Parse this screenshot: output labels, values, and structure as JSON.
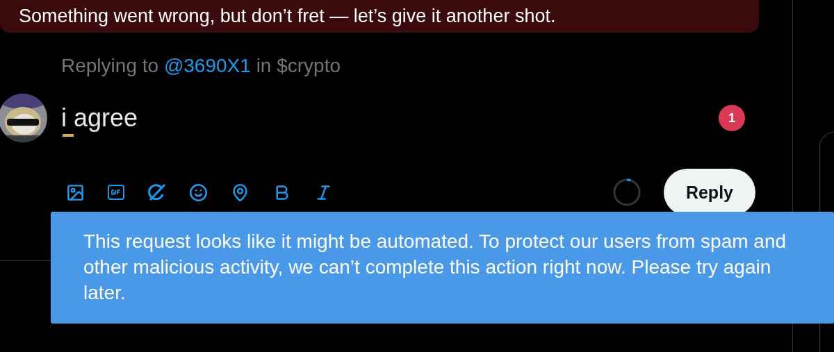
{
  "error_banner": {
    "text": "Something went wrong, but don’t fret — let’s give it another shot."
  },
  "replying_to": {
    "prefix": "Replying to",
    "handle": "@3690X1",
    "suffix": "in $crypto"
  },
  "composer": {
    "text": "i agree",
    "spellcheck_word_flagged": true,
    "badge": "1",
    "level": 0.05
  },
  "toolbar": [
    {
      "kind": "image"
    },
    {
      "kind": "gif"
    },
    {
      "kind": "grok"
    },
    {
      "kind": "emoji"
    },
    {
      "kind": "location"
    },
    {
      "kind": "bold"
    },
    {
      "kind": "italic"
    }
  ],
  "reply_button": {
    "label": "Reply"
  },
  "toast": {
    "text": "This request looks like it might be automated. To protect our users from spam and other malicious activity, we can’t complete this action right now. Please try again later."
  }
}
